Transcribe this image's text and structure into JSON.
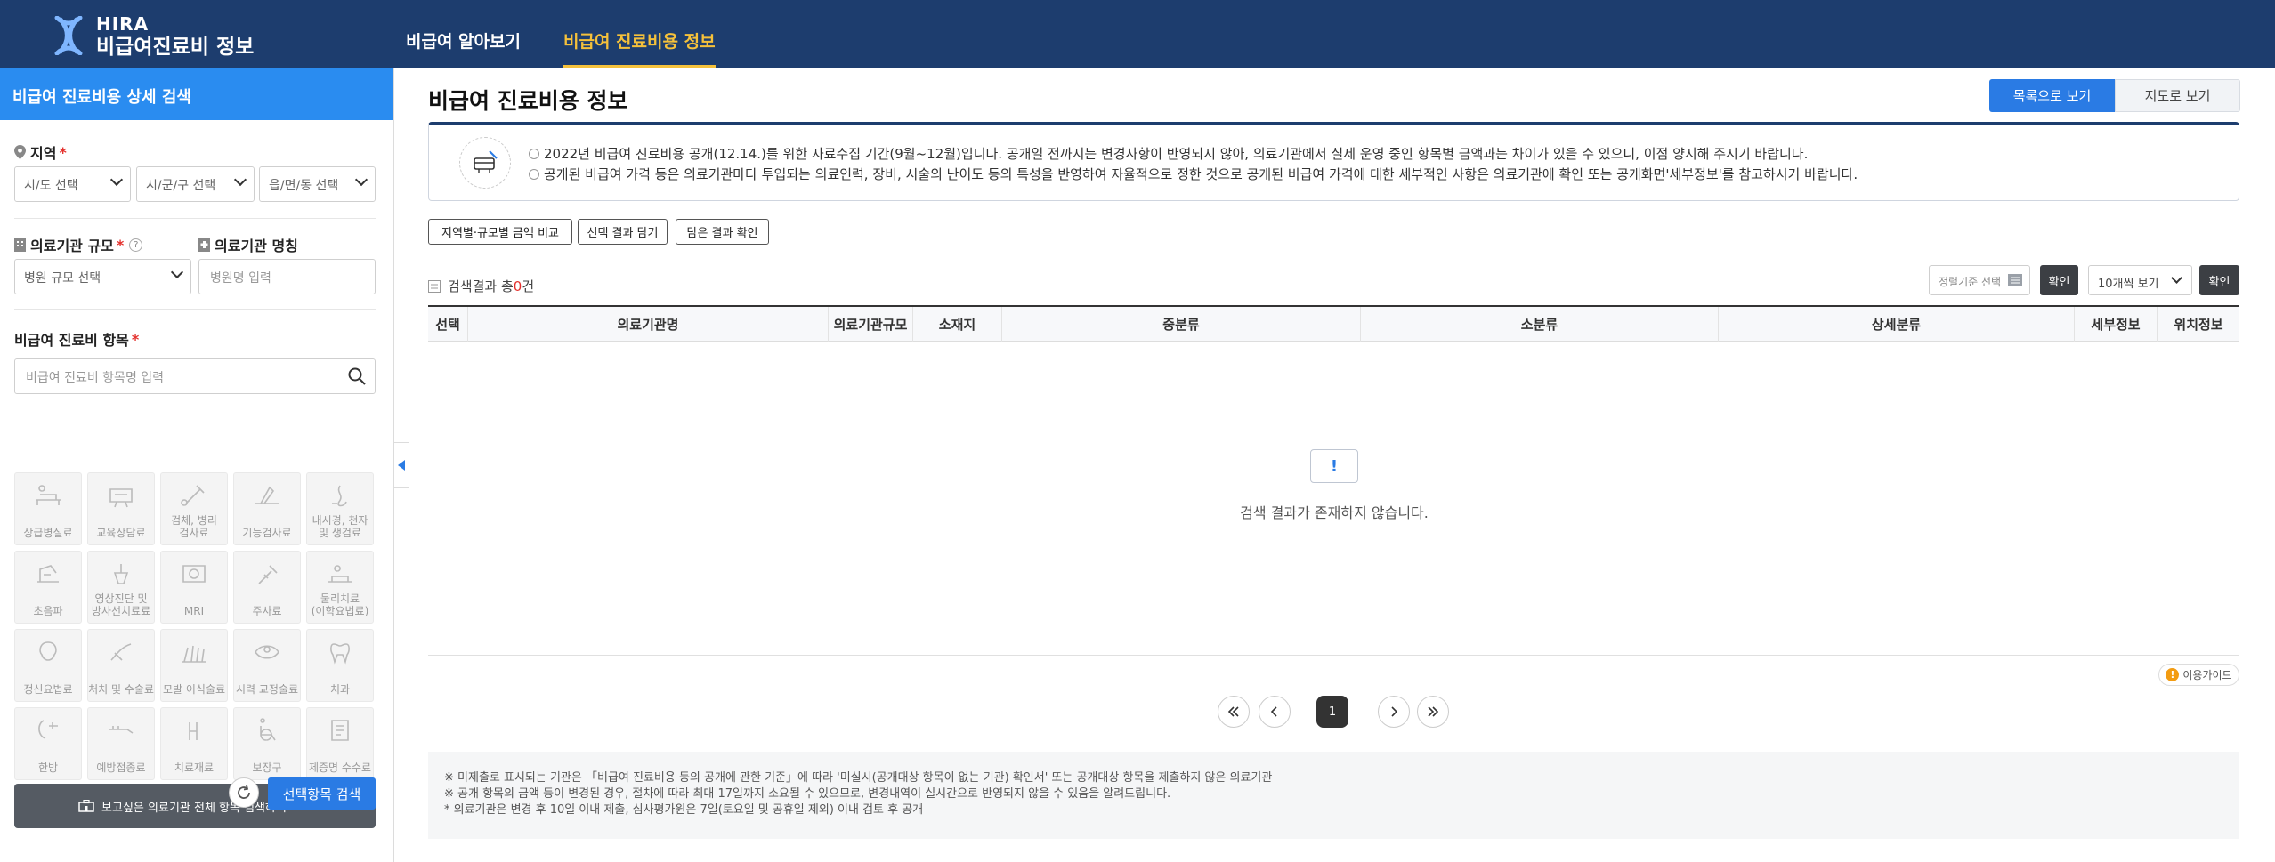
{
  "header": {
    "logo_top": "HIRA",
    "logo_bottom": "비급여진료비 정보",
    "nav": [
      {
        "label": "비급여 알아보기",
        "active": false
      },
      {
        "label": "비급여 진료비용 정보",
        "active": true
      }
    ]
  },
  "sidebar": {
    "title": "비급여 진료비용 상세 검색",
    "region": {
      "label": "지역",
      "required": "*",
      "selects": [
        "시/도 선택",
        "시/군/구 선택",
        "읍/면/동 선택"
      ]
    },
    "scale": {
      "label": "의료기관 규모",
      "required": "*",
      "help": "?",
      "select": "병원 규모 선택"
    },
    "name": {
      "label": "의료기관 명칭",
      "placeholder": "병원명 입력"
    },
    "item": {
      "label": "비급여 진료비 항목",
      "required": "*",
      "placeholder": "비급여 진료비 항목명 입력"
    },
    "categories": [
      {
        "label": "상급병실료",
        "icon": "hospital-bed-icon"
      },
      {
        "label": "교육상담료",
        "icon": "consultation-icon"
      },
      {
        "label": "검체, 병리\n검사료",
        "icon": "lab-test-icon"
      },
      {
        "label": "기능검사료",
        "icon": "function-test-icon"
      },
      {
        "label": "내시경, 천자\n및 생검료",
        "icon": "endoscope-icon"
      },
      {
        "label": "초음파",
        "icon": "ultrasound-icon"
      },
      {
        "label": "영상진단 및\n방사선치료료",
        "icon": "radiology-icon"
      },
      {
        "label": "MRI",
        "icon": "mri-icon"
      },
      {
        "label": "주사료",
        "icon": "injection-icon"
      },
      {
        "label": "물리치료\n(이학요법료)",
        "icon": "physical-therapy-icon"
      },
      {
        "label": "정신요법료",
        "icon": "psychotherapy-icon"
      },
      {
        "label": "처치 및 수술료",
        "icon": "surgery-icon"
      },
      {
        "label": "모발 이식술료",
        "icon": "hair-transplant-icon"
      },
      {
        "label": "시력 교정술료",
        "icon": "eye-correction-icon"
      },
      {
        "label": "치과",
        "icon": "tooth-icon"
      },
      {
        "label": "한방",
        "icon": "oriental-medicine-icon"
      },
      {
        "label": "예방접종료",
        "icon": "vaccination-icon"
      },
      {
        "label": "치료재료",
        "icon": "treatment-material-icon"
      },
      {
        "label": "보장구",
        "icon": "wheelchair-icon"
      },
      {
        "label": "제증명 수수료",
        "icon": "certificate-icon"
      }
    ],
    "all_button": "보고싶은 의료기관 전체 항목 검색하기",
    "search_button": "선택항목 검색"
  },
  "main": {
    "title": "비급여 진료비용 정보",
    "view_list": "목록으로 보기",
    "view_map": "지도로 보기",
    "notices": [
      "2022년 비급여 진료비용 공개(12.14.)를 위한 자료수집 기간(9월~12월)입니다. 공개일 전까지는 변경사항이 반영되지 않아, 의료기관에서 실제 운영 중인 항목별 금액과는 차이가 있을 수 있으니, 이점 양지해 주시기 바랍니다.",
      "공개된 비급여 가격 등은 의료기관마다 투입되는 의료인력, 장비, 시술의 난이도 등의 특성을 반영하여 자율적으로 정한 것으로 공개된 비급여 가격에 대한 세부적인 사항은 의료기관에 확인 또는 공개화면'세부정보'를 참고하시기 바랍니다."
    ],
    "actions": [
      "지역별·규모별 금액 비교",
      "선택 결과 담기",
      "담은 결과 확인"
    ],
    "result_prefix": "검색결과 총",
    "result_count": "0",
    "result_suffix": "건",
    "sort_placeholder": "정렬기준 선택",
    "confirm": "확인",
    "per_page": "10개씩 보기",
    "columns": [
      "선택",
      "의료기관명",
      "의료기관규모",
      "소재지",
      "중분류",
      "소분류",
      "상세분류",
      "세부정보",
      "위치정보"
    ],
    "empty_text": "검색 결과가 존재하지 않습니다.",
    "empty_mark": "!",
    "guide": "이용가이드",
    "guide_mark": "!",
    "current_page": "1",
    "footnotes": [
      "※ 미제출로 표시되는 기관은 「비급여 진료비용 등의 공개에 관한 기준」에 따라 '미실시(공개대상 항목이 없는 기관) 확인서' 또는 공개대상 항목을 제출하지 않은 의료기관",
      "※ 공개 항목의 금액 등이 변경된 경우, 절차에 따라 최대 17일까지 소요될 수 있으므로, 변경내역이 실시간으로 반영되지 않을 수 있음을 알려드립니다.",
      "* 의료기관은 변경 후 10일 이내 제출, 심사평가원은 7일(토요일 및 공휴일 제외) 이내 검토 후 공개"
    ]
  },
  "colors": {
    "header_bg": "#1d3d6e",
    "accent_blue": "#2a7be4",
    "active_nav": "#f5c13b",
    "required": "#e4302c"
  }
}
